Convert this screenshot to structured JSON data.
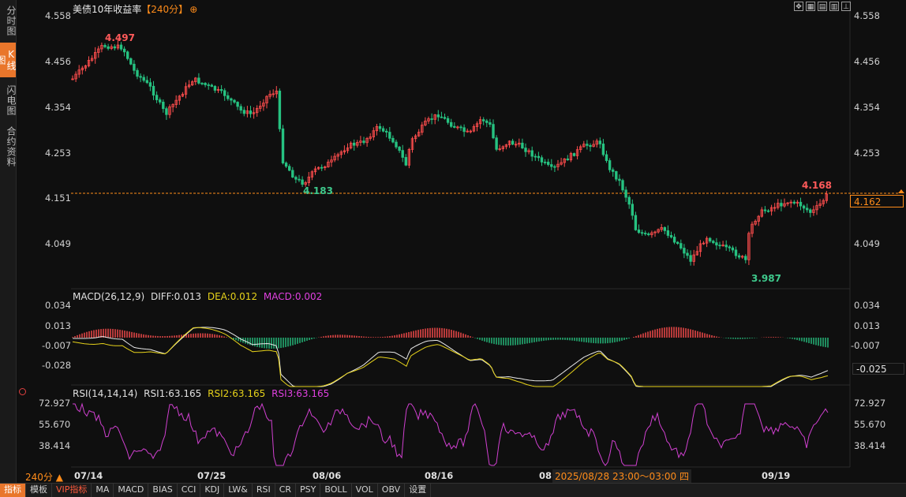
{
  "sidebar": {
    "items": [
      {
        "label": "分时图",
        "active": false
      },
      {
        "label": "K线图",
        "active": true
      },
      {
        "label": "闪电图",
        "active": false
      },
      {
        "label": "合约资料",
        "active": false
      }
    ]
  },
  "header": {
    "title": "美债10年收益率",
    "period": "【240分】",
    "plus_icon": "⊕",
    "toolbar_icons": [
      "expand-icon",
      "grid-icon",
      "book-icon",
      "layout-icon",
      "down-icon"
    ]
  },
  "price_panel": {
    "y_ticks": [
      "4.558",
      "4.456",
      "4.354",
      "4.253",
      "4.151",
      "4.049"
    ],
    "current_price": "4.162",
    "high_label": "4.497",
    "low_label_1": "4.183",
    "low_label_2": "3.987",
    "recent_high_label": "4.168",
    "colors": {
      "up": "#ff4d4d",
      "down": "#26c281",
      "current_line": "#ff8c1a"
    }
  },
  "macd_panel": {
    "label": "MACD(26,12,9)",
    "diff_label": "DIFF:0.013",
    "dea_label": "DEA:0.012",
    "macd_label": "MACD:0.002",
    "y_ticks": [
      "0.034",
      "0.013",
      "-0.007",
      "-0.028"
    ],
    "current_tag": "-0.025"
  },
  "rsi_panel": {
    "label": "RSI(14,14,14)",
    "rsi1_label": "RSI1:63.165",
    "rsi2_label": "RSI2:63.165",
    "rsi3_label": "RSI3:63.165",
    "y_ticks": [
      "72.927",
      "55.670",
      "38.414"
    ]
  },
  "xaxis": {
    "period_select": "240分",
    "dates": [
      "07/14",
      "07/25",
      "08/06",
      "08/16",
      "08",
      "09/19"
    ],
    "crosshair": "2025/08/28 23:00～03:00 四"
  },
  "bottombar": {
    "items": [
      "指标",
      "模板",
      "VIP指标",
      "MA",
      "MACD",
      "BIAS",
      "CCI",
      "KDJ",
      "LW&",
      "RSI",
      "CR",
      "PSY",
      "BOLL",
      "VOL",
      "OBV",
      "设置"
    ]
  }
}
